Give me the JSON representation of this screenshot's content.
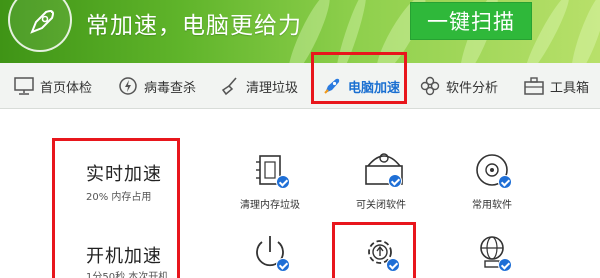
{
  "header": {
    "slogan": "常加速，电脑更给力",
    "scan_button": "一键扫描"
  },
  "nav": {
    "tabs": [
      {
        "label": "首页体检",
        "icon": "monitor-icon"
      },
      {
        "label": "病毒查杀",
        "icon": "shield-bolt-icon"
      },
      {
        "label": "清理垃圾",
        "icon": "broom-icon"
      },
      {
        "label": "电脑加速",
        "icon": "rocket-icon",
        "active": true
      },
      {
        "label": "软件分析",
        "icon": "flower-icon"
      },
      {
        "label": "工具箱",
        "icon": "toolbox-icon"
      }
    ]
  },
  "modes": [
    {
      "title": "实时加速",
      "subtitle": "20% 内存占用"
    },
    {
      "title": "开机加速",
      "subtitle": "1分50秒 本次开机"
    }
  ],
  "tiles": [
    {
      "label": "清理内存垃圾",
      "icon": "memory-chip-icon"
    },
    {
      "label": "可关闭软件",
      "icon": "software-box-icon"
    },
    {
      "label": "常用软件",
      "icon": "disc-icon"
    },
    {
      "label": "",
      "icon": "power-icon"
    },
    {
      "label": "",
      "icon": "gear-upload-icon"
    },
    {
      "label": "",
      "icon": "network-globe-icon"
    }
  ],
  "colors": {
    "accent": "#1f6fd6",
    "highlight": "#e8161c",
    "scan_button": "#2fb83a"
  }
}
